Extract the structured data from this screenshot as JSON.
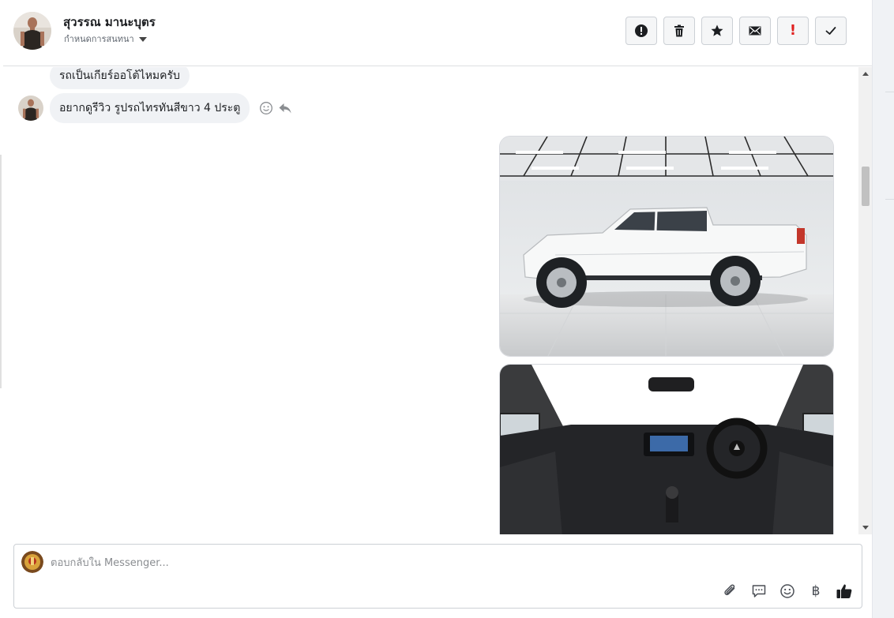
{
  "header": {
    "contact_name": "สุวรรณ มานะบุตร",
    "conversation_settings_label": "กำหนดการสนทนา",
    "actions": [
      {
        "name": "report-spam-button",
        "icon": "exclamation-circle-icon"
      },
      {
        "name": "delete-button",
        "icon": "trash-icon"
      },
      {
        "name": "star-button",
        "icon": "star-icon"
      },
      {
        "name": "mark-unread-button",
        "icon": "envelope-icon"
      },
      {
        "name": "mark-important-button",
        "glyph": "!"
      },
      {
        "name": "mark-done-button",
        "icon": "check-icon"
      }
    ]
  },
  "thread": {
    "messages": [
      {
        "sender": "contact",
        "text": "รถเป็นเกียร์ออโต้ไหมครับ"
      },
      {
        "sender": "contact",
        "text": "อยากดูรีวิว รูปรถไทรทันสีขาว 4 ประตู"
      }
    ],
    "message_tools": [
      "emoji-react-icon",
      "reply-icon"
    ],
    "photos": [
      {
        "name": "photo-truck-exterior",
        "subject": "white 4-door pickup truck side view in studio"
      },
      {
        "name": "photo-truck-interior",
        "subject": "pickup truck dashboard interior"
      }
    ]
  },
  "composer": {
    "placeholder": "ตอบกลับใน Messenger...",
    "value": "",
    "tools": [
      "paperclip-icon",
      "saved-replies-icon",
      "emoji-icon",
      "baht-currency-icon",
      "thumbs-up-icon"
    ],
    "currency_symbol": "฿"
  },
  "colors": {
    "bubble_bg": "#f0f2f5",
    "border": "#ccd0d5",
    "important_red": "#e02020"
  }
}
